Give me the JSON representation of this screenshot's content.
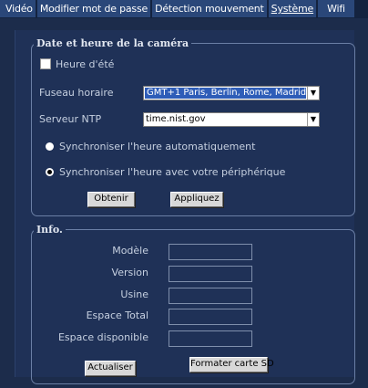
{
  "tabs": [
    {
      "label": "Vidéo"
    },
    {
      "label": "Modifier mot de passe"
    },
    {
      "label": "Détection mouvement"
    },
    {
      "label": "Système"
    },
    {
      "label": "Wifi"
    }
  ],
  "active_tab": "Système",
  "datetime": {
    "legend": "Date et heure de la caméra",
    "dst_label": "Heure d'été",
    "dst_checked": false,
    "timezone_label": "Fuseau horaire",
    "timezone_value": "GMT+1  Paris, Berlin, Rome, Madrid;",
    "ntp_label": "Serveur NTP",
    "ntp_value": "time.nist.gov",
    "sync_auto_label": "Synchroniser l'heure automatiquement",
    "sync_device_label": "Synchroniser l'heure avec votre périphérique",
    "selected_sync": "device",
    "get_button": "Obtenir",
    "apply_button": "Appliquez"
  },
  "info": {
    "legend": "Info.",
    "model_label": "Modèle",
    "version_label": "Version",
    "factory_label": "Usine",
    "total_space_label": "Espace Total",
    "free_space_label": "Espace disponible",
    "refresh_button": "Actualiser",
    "format_button": "Formater carte SD"
  },
  "colors": {
    "background": "#1c2c4b",
    "tab": "#2a4779",
    "highlight": "#2e5db8"
  }
}
